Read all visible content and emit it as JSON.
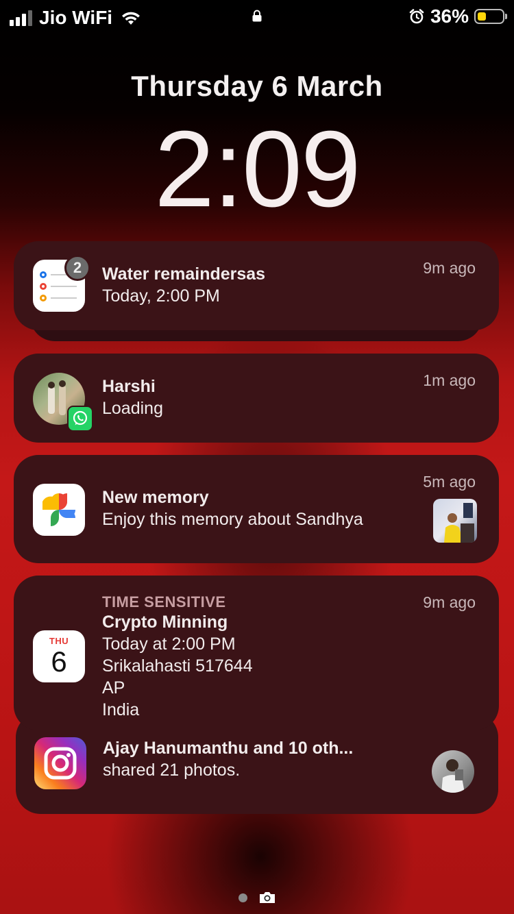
{
  "status_bar": {
    "carrier": "Jio WiFi",
    "battery_percent": "36%",
    "battery_level": 0.36,
    "battery_color": "#ffd60a",
    "icons": [
      "signal-icon",
      "wifi-icon",
      "lock-icon",
      "alarm-icon",
      "battery-icon"
    ]
  },
  "lock_screen": {
    "date": "Thursday 6 March",
    "time": "2:09"
  },
  "notifications": [
    {
      "app": "Reminders",
      "icon": "reminders-icon",
      "badge": "2",
      "title": "Water remaindersas",
      "body": "Today, 2:00 PM",
      "time": "9m ago"
    },
    {
      "app": "WhatsApp",
      "icon": "whatsapp-icon",
      "title": "Harshi",
      "body": "Loading",
      "time": "1m ago"
    },
    {
      "app": "Photos",
      "icon": "photos-icon",
      "title": "New memory",
      "body": "Enjoy this memory about Sandhya",
      "time": "5m ago"
    },
    {
      "app": "Calendar",
      "icon": "calendar-icon",
      "calendar_day": "THU",
      "calendar_date": "6",
      "label": "TIME SENSITIVE",
      "title": "Crypto Minning",
      "body": "Today at 2:00 PM\nSrikalahasti 517644\nAP\nIndia",
      "time": "9m ago"
    },
    {
      "app": "Instagram",
      "icon": "instagram-icon",
      "title": "Ajay Hanumanthu and 10 oth...",
      "body": "shared 21 photos."
    }
  ],
  "colors": {
    "notification_bg": "#3b1317",
    "wallpaper_red": "#c41818"
  }
}
